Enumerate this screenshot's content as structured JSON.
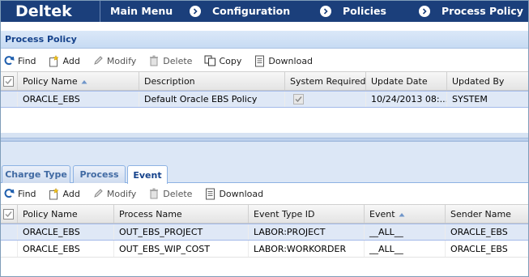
{
  "nav": {
    "logo": "Deltek",
    "items": [
      "Main Menu",
      "Configuration",
      "Policies",
      "Process Policy"
    ]
  },
  "process_policy": {
    "title": "Process Policy",
    "toolbar": {
      "find": "Find",
      "add": "Add",
      "modify": "Modify",
      "delete": "Delete",
      "copy": "Copy",
      "download": "Download"
    },
    "columns": [
      "Policy Name",
      "Description",
      "System Required",
      "Update Date",
      "Updated By"
    ],
    "rows": [
      {
        "policy_name": "ORACLE_EBS",
        "description": "Default Oracle EBS Policy",
        "system_required": true,
        "update_date": "10/24/2013 08:...",
        "updated_by": "SYSTEM"
      }
    ]
  },
  "tabs": {
    "items": [
      "Charge Type",
      "Process",
      "Event"
    ],
    "active": "Event"
  },
  "event_panel": {
    "toolbar": {
      "find": "Find",
      "add": "Add",
      "modify": "Modify",
      "delete": "Delete",
      "download": "Download"
    },
    "columns": [
      "Policy Name",
      "Process Name",
      "Event Type ID",
      "Event",
      "Sender Name"
    ],
    "rows": [
      {
        "policy_name": "ORACLE_EBS",
        "process_name": "OUT_EBS_PROJECT",
        "event_type_id": "LABOR:PROJECT",
        "event": "__ALL__",
        "sender_name": "ORACLE_EBS"
      },
      {
        "policy_name": "ORACLE_EBS",
        "process_name": "OUT_EBS_WIP_COST",
        "event_type_id": "LABOR:WORKORDER",
        "event": "__ALL__",
        "sender_name": "ORACLE_EBS"
      }
    ]
  },
  "colors": {
    "nav_bg": "#1b3f7b",
    "panel_header_text": "#15428b",
    "selected_row": "#dfe8f6"
  }
}
